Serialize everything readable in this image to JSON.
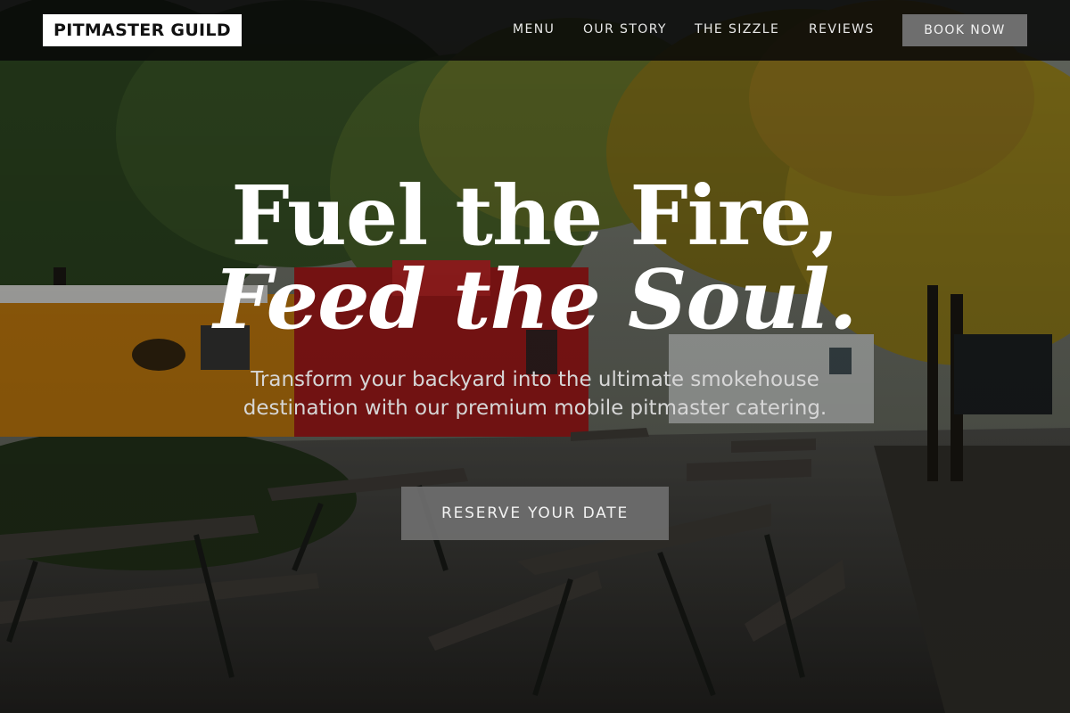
{
  "brand": {
    "name": "PITMASTER GUILD"
  },
  "nav": {
    "links": [
      "MENU",
      "OUR STORY",
      "THE SIZZLE",
      "REVIEWS"
    ],
    "cta_label": "BOOK NOW"
  },
  "hero": {
    "headline_line1": "Fuel the Fire,",
    "headline_line2": "Feed the Soul.",
    "subtitle": "Transform your backyard into the ultimate smokehouse destination with our premium mobile pitmaster catering.",
    "cta_label": "RESERVE YOUR DATE"
  },
  "colors": {
    "navbar_bg": "#080808",
    "brand_bg": "#ffffff",
    "button_bg": "#6e6e6e",
    "text_light": "#ffffff"
  },
  "icons": {
    "background": "food-truck-park-photo"
  }
}
